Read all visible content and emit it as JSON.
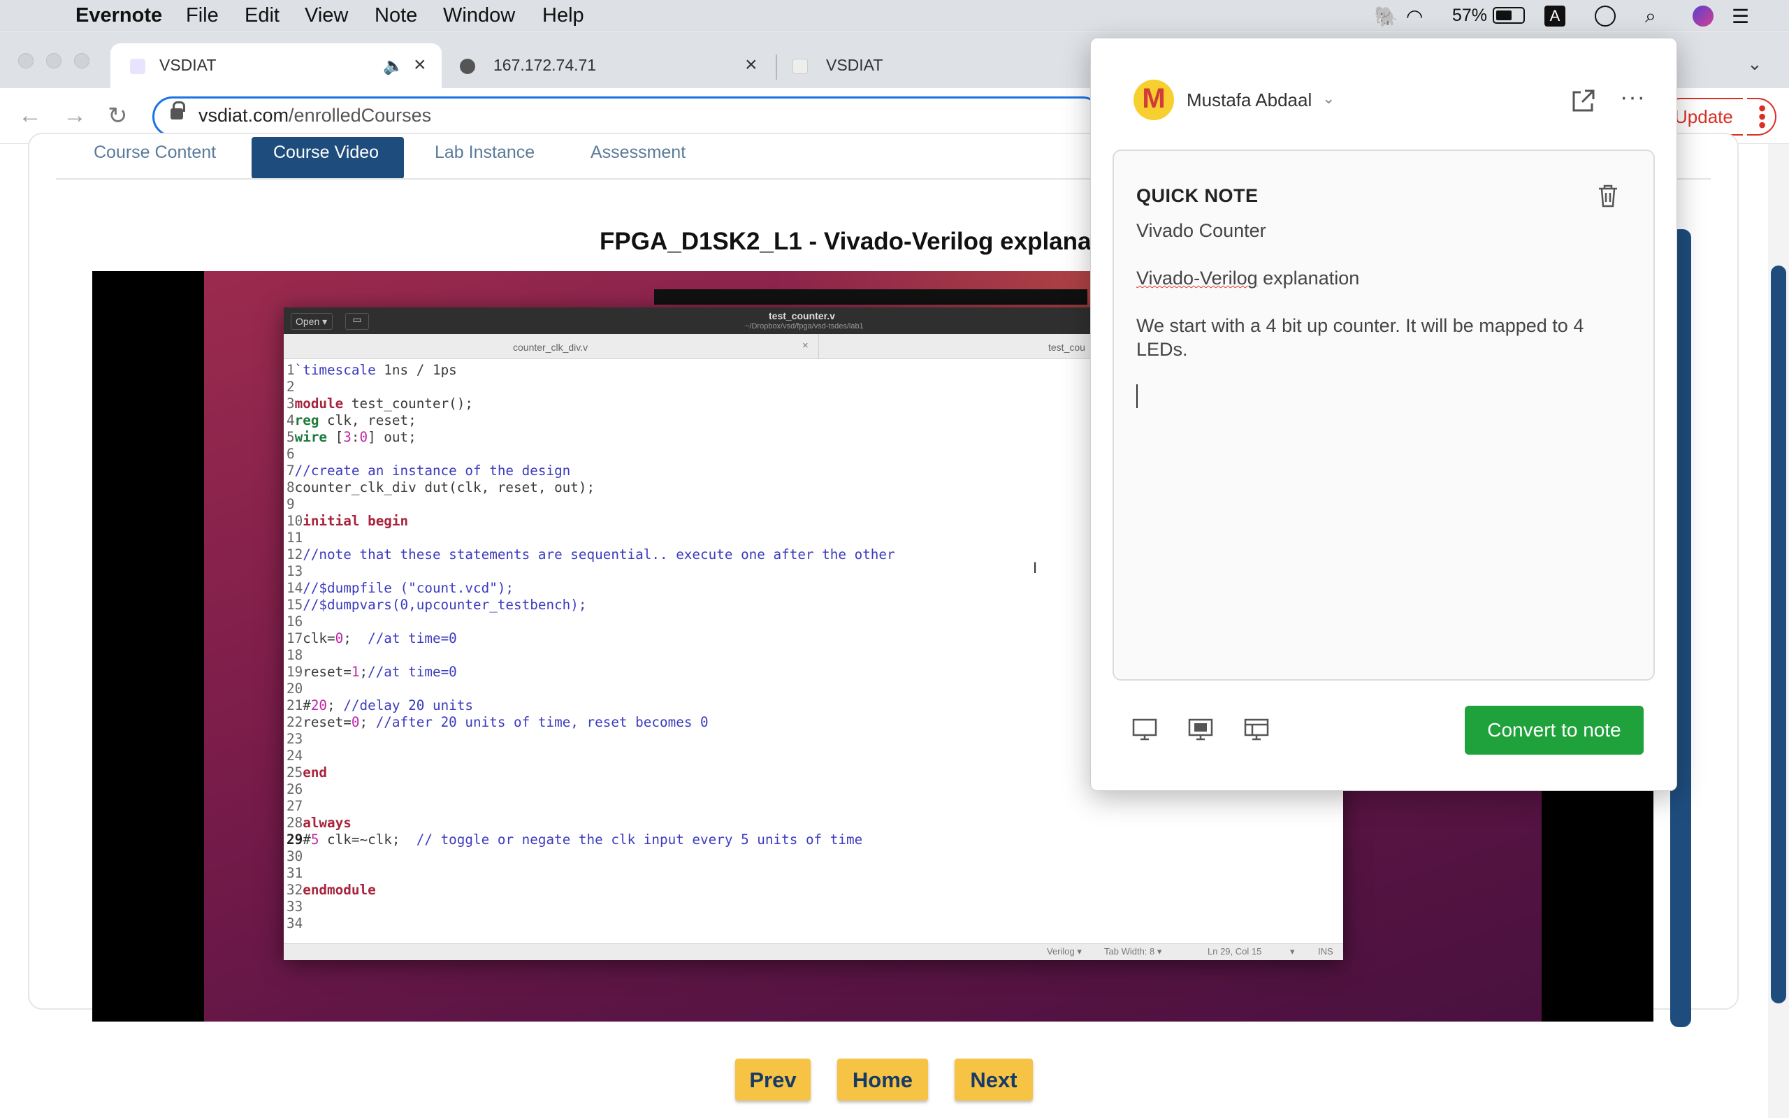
{
  "menubar": {
    "app": "Evernote",
    "items": [
      "File",
      "Edit",
      "View",
      "Note",
      "Window",
      "Help"
    ],
    "battery": "57%",
    "input_source": "A"
  },
  "tabs": [
    {
      "title": "VSDIAT",
      "active": true
    },
    {
      "title": "167.172.74.71",
      "active": false
    },
    {
      "title": "VSDIAT",
      "active": false
    }
  ],
  "address": {
    "domain": "vsdiat.com",
    "path": "/enrolledCourses"
  },
  "update_button": "Update",
  "course_tabs": [
    "Course Content",
    "Course Video",
    "Lab Instance",
    "Assessment"
  ],
  "video": {
    "title": "FPGA_D1SK2_L1 - Vivado-Verilog explana",
    "editor_filename": "test_counter.v",
    "editor_path": "~/Dropbox/vsd/fpga/vsd-tsdes/lab1",
    "editor_open": "Open ▾",
    "editor_tab1": "counter_clk_div.v",
    "editor_tab2": "test_cou",
    "status": {
      "lang": "Verilog ▾",
      "tab": "Tab Width: 8 ▾",
      "pos": "Ln 29, Col 15",
      "mode": "INS"
    }
  },
  "nav_buttons": {
    "prev": "Prev",
    "home": "Home",
    "next": "Next"
  },
  "evernote": {
    "user": "Mustafa Abdaal",
    "avatar_letter": "M",
    "header": "QUICK NOTE",
    "note_title": "Vivado Counter",
    "paragraph1_a": "Vivado-Verilog",
    "paragraph1_b": " explanation",
    "paragraph2": "We start with a 4 bit up counter. It will be mapped to 4 LEDs.",
    "convert_button": "Convert to note",
    "accent": "#1fa23b"
  }
}
